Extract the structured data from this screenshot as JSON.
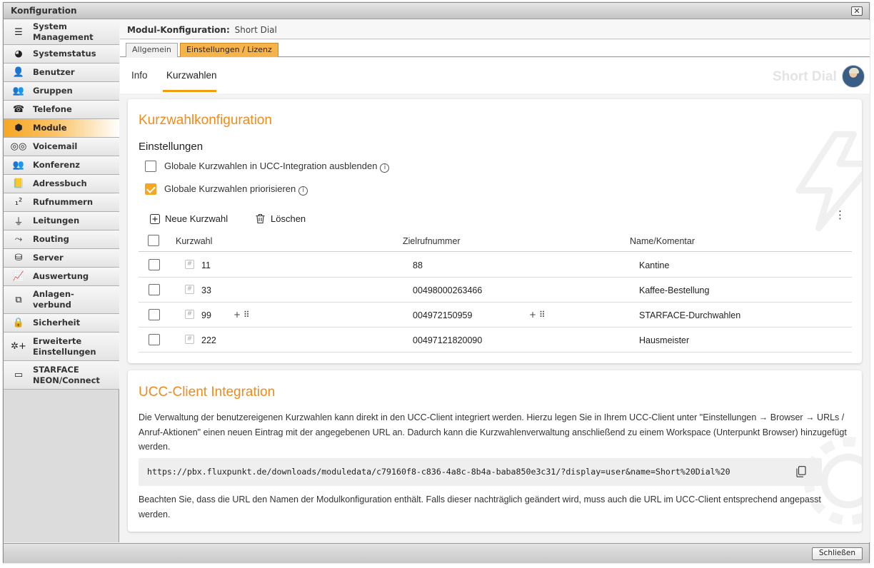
{
  "window": {
    "title": "Konfiguration",
    "close_glyph": "✕"
  },
  "sidebar": {
    "items": [
      {
        "label": "System\nManagement",
        "icon": "list-icon",
        "glyph": "☰"
      },
      {
        "label": "Systemstatus",
        "icon": "status-icon",
        "glyph": "◕"
      },
      {
        "label": "Benutzer",
        "icon": "user-icon",
        "glyph": "👤"
      },
      {
        "label": "Gruppen",
        "icon": "group-icon",
        "glyph": "👥"
      },
      {
        "label": "Telefone",
        "icon": "phone-icon",
        "glyph": "☎"
      },
      {
        "label": "Module",
        "icon": "module-icon",
        "glyph": "⬢"
      },
      {
        "label": "Voicemail",
        "icon": "voicemail-icon",
        "glyph": "◎◎"
      },
      {
        "label": "Konferenz",
        "icon": "conference-icon",
        "glyph": "👥"
      },
      {
        "label": "Adressbuch",
        "icon": "addressbook-icon",
        "glyph": "📒"
      },
      {
        "label": "Rufnummern",
        "icon": "numbers-icon",
        "glyph": "₁²"
      },
      {
        "label": "Leitungen",
        "icon": "line-icon",
        "glyph": "⏚"
      },
      {
        "label": "Routing",
        "icon": "routing-icon",
        "glyph": "⤳"
      },
      {
        "label": "Server",
        "icon": "server-icon",
        "glyph": "⛁"
      },
      {
        "label": "Auswertung",
        "icon": "chart-icon",
        "glyph": "📈"
      },
      {
        "label": "Anlagen-\nverbund",
        "icon": "network-icon",
        "glyph": "⧉"
      },
      {
        "label": "Sicherheit",
        "icon": "lock-icon",
        "glyph": "🔒"
      },
      {
        "label": "Erweiterte\nEinstellungen",
        "icon": "advanced-settings-icon",
        "glyph": "✲+"
      },
      {
        "label": "STARFACE\nNEON/Connect",
        "icon": "connect-icon",
        "glyph": "▭"
      }
    ],
    "active_index": 5
  },
  "module": {
    "header_label": "Modul-Konfiguration:",
    "header_value": "Short Dial"
  },
  "tabs": [
    {
      "label": "Allgemein"
    },
    {
      "label": "Einstellungen / Lizenz"
    }
  ],
  "subnav": {
    "items": [
      {
        "label": "Info"
      },
      {
        "label": "Kurzwahlen"
      }
    ],
    "brand_ghost": "Short Dial"
  },
  "config": {
    "title": "Kurzwahlkonfiguration",
    "settings_heading": "Einstellungen",
    "options": [
      {
        "label": "Globale Kurzwahlen in UCC-Integration ausblenden",
        "checked": false
      },
      {
        "label": "Globale Kurzwahlen priorisieren",
        "checked": true
      }
    ],
    "info_glyph": "i",
    "toolbar": {
      "new_label": "Neue Kurzwahl",
      "delete_label": "Löschen",
      "more_glyph": "⋮"
    },
    "table": {
      "headers": [
        "Kurzwahl",
        "Zielrufnummer",
        "Name/Komentar"
      ],
      "rows": [
        {
          "code": "11",
          "target": "88",
          "name": "Kantine"
        },
        {
          "code": "33",
          "target": "00498000263466",
          "name": "Kaffee-Bestellung"
        },
        {
          "code": "99",
          "target": "004972150959",
          "name": "STARFACE-Durchwahlen"
        },
        {
          "code": "222",
          "target": "00497121820090",
          "name": "Hausmeister"
        }
      ],
      "hash_glyph": "#",
      "dialpad_glyph": "+ ⠿"
    }
  },
  "ucc": {
    "title": "UCC-Client Integration",
    "intro": "Die Verwaltung der benutzereigenen Kurzwahlen kann direkt in den UCC-Client integriert werden. Hierzu legen Sie in Ihrem UCC-Client unter \"Einstellungen → Browser → URLs / Anruf-Aktionen\" einen neuen Eintrag mit der angegebenen URL an. Dadurch kann die Kurzwahlenverwaltung anschließend zu einem Workspace (Unterpunkt Browser) hinzugefügt werden.",
    "url": "https://pbx.fluxpunkt.de/downloads/moduledata/c79160f8-c836-4a8c-8b4a-baba850e3c31/?display=user&name=Short%20Dial%20",
    "note": "Beachten Sie, dass die URL den Namen der Modulkonfiguration enthält. Falls dieser nachträglich geändert wird, muss auch die URL im UCC-Client entsprechend angepasst werden."
  },
  "footer": {
    "close_label": "Schließen"
  },
  "colors": {
    "accent": "#ef8c1b",
    "active_tab": "#f6b34a",
    "checkbox": "#f5a623"
  }
}
